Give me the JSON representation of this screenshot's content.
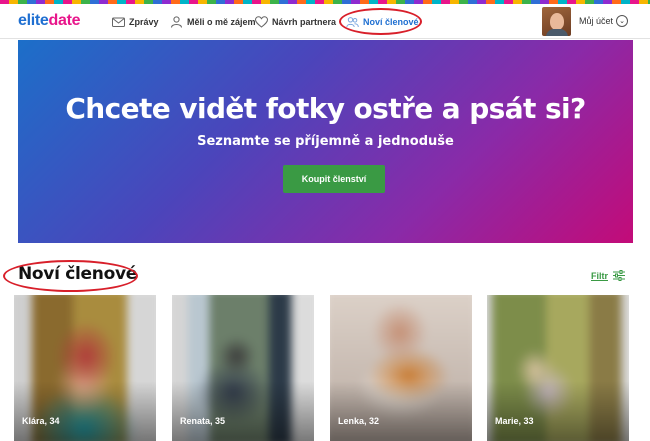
{
  "app": {
    "logo_part1": "elite",
    "logo_part2": "date"
  },
  "nav": {
    "messages": "Zprávy",
    "interested": "Měli o mě zájem",
    "partner": "Návrh partnera",
    "new_members": "Noví členové",
    "account": "Můj účet"
  },
  "banner": {
    "title": "Chcete vidět fotky ostře a psát si?",
    "subtitle": "Seznamte se příjemně a jednoduše",
    "button": "Koupit členství"
  },
  "section": {
    "title": "Noví členové",
    "filter": "Filtr"
  },
  "members": [
    {
      "name": "Klára, 34"
    },
    {
      "name": "Renata, 35"
    },
    {
      "name": "Lenka, 32"
    },
    {
      "name": "Marie, 33"
    }
  ],
  "colors": {
    "brand_blue": "#1f6fd1",
    "brand_pink": "#e8168b",
    "cta_green": "#3a9a44",
    "annotation_red": "#d81f2a"
  },
  "icons": {
    "messages": "envelope-icon",
    "interested": "person-icon",
    "partner": "heart-icon",
    "new_members": "people-icon",
    "account": "chevron-down-icon",
    "filter": "sliders-icon"
  }
}
